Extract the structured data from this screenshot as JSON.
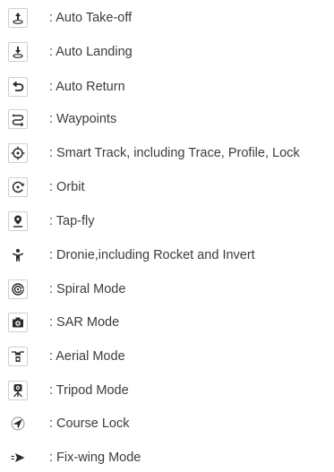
{
  "items": [
    {
      "icon": "auto-takeoff-icon",
      "label": ": Auto Take-off"
    },
    {
      "icon": "auto-landing-icon",
      "label": ": Auto Landing"
    },
    {
      "icon": "auto-return-icon",
      "label": ": Auto Return"
    },
    {
      "icon": "waypoints-icon",
      "label": ": Waypoints"
    },
    {
      "icon": "smart-track-icon",
      "label": ": Smart Track, including Trace, Profile, Lock"
    },
    {
      "icon": "orbit-icon",
      "label": ": Orbit"
    },
    {
      "icon": "tap-fly-icon",
      "label": ": Tap-fly"
    },
    {
      "icon": "dronie-icon",
      "label": ": Dronie,including Rocket and Invert"
    },
    {
      "icon": "spiral-mode-icon",
      "label": ": Spiral Mode"
    },
    {
      "icon": "sar-mode-icon",
      "label": ": SAR Mode"
    },
    {
      "icon": "aerial-mode-icon",
      "label": ": Aerial Mode"
    },
    {
      "icon": "tripod-mode-icon",
      "label": ": Tripod Mode"
    },
    {
      "icon": "course-lock-icon",
      "label": ": Course Lock"
    },
    {
      "icon": "fix-wing-mode-icon",
      "label": ": Fix-wing Mode"
    }
  ],
  "colors": {
    "icon": "#2a2a2a",
    "border": "#cfcfcf",
    "text": "#3c3c3c"
  }
}
